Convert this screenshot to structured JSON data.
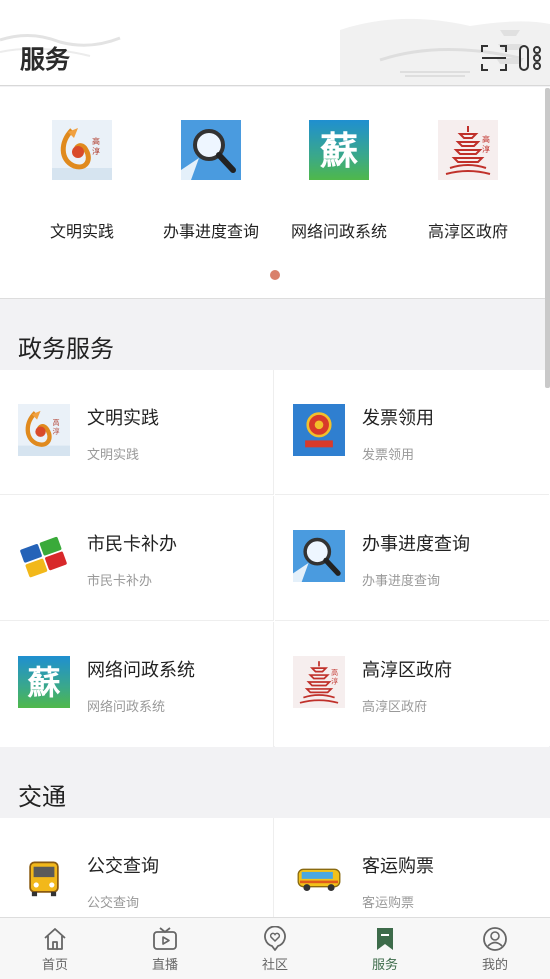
{
  "header": {
    "title": "服务"
  },
  "carousel": {
    "items": [
      {
        "label": "文明实践",
        "icon": "wenming-logo-icon"
      },
      {
        "label": "办事进度查询",
        "icon": "magnifier-icon"
      },
      {
        "label": "网络问政系统",
        "icon": "su-calligraphy-icon"
      },
      {
        "label": "高淳区政府",
        "icon": "pagoda-icon"
      }
    ],
    "active_page": 1,
    "dot_color": "#d9806a"
  },
  "sections": [
    {
      "title": "政务服务",
      "items": [
        {
          "name": "文明实践",
          "sub": "文明实践",
          "icon": "wenming-logo-icon"
        },
        {
          "name": "发票领用",
          "sub": "发票领用",
          "icon": "tax-emblem-icon"
        },
        {
          "name": "市民卡补办",
          "sub": "市民卡补办",
          "icon": "citizen-card-icon"
        },
        {
          "name": "办事进度查询",
          "sub": "办事进度查询",
          "icon": "magnifier-icon"
        },
        {
          "name": "网络问政系统",
          "sub": "网络问政系统",
          "icon": "su-calligraphy-icon"
        },
        {
          "name": "高淳区政府",
          "sub": "高淳区政府",
          "icon": "pagoda-icon"
        }
      ]
    },
    {
      "title": "交通",
      "items": [
        {
          "name": "公交查询",
          "sub": "公交查询",
          "icon": "bus-front-icon"
        },
        {
          "name": "客运购票",
          "sub": "客运购票",
          "icon": "coach-bus-icon"
        }
      ]
    }
  ],
  "tabbar": {
    "items": [
      {
        "label": "首页",
        "icon": "home-icon"
      },
      {
        "label": "直播",
        "icon": "tv-play-icon"
      },
      {
        "label": "社区",
        "icon": "heart-chat-icon"
      },
      {
        "label": "服务",
        "icon": "bookmark-icon"
      },
      {
        "label": "我的",
        "icon": "user-icon"
      }
    ],
    "active": "服务",
    "active_color": "#3d6b4a"
  }
}
